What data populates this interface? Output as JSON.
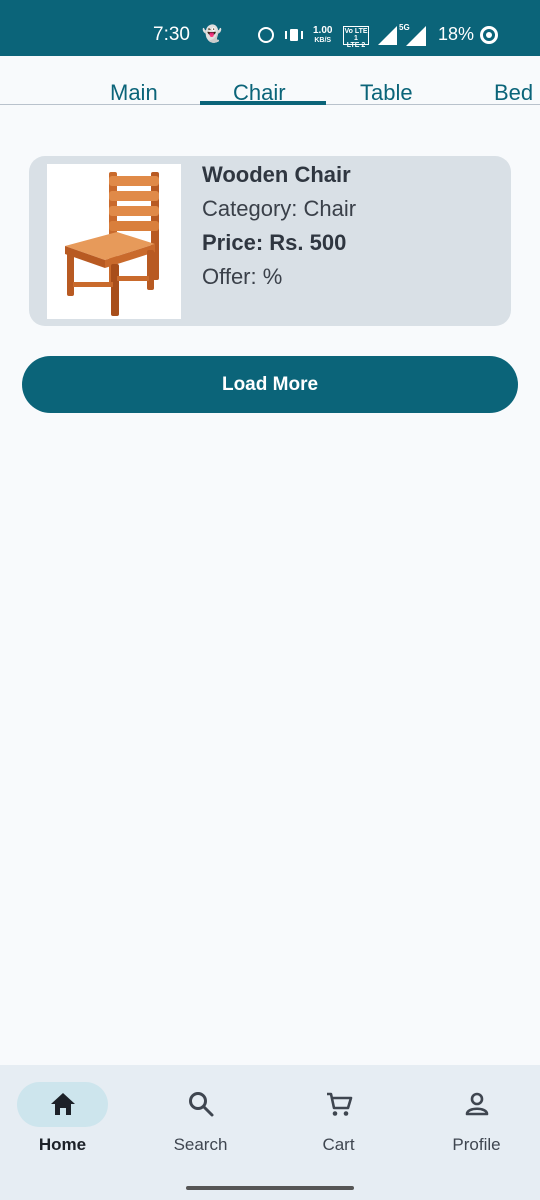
{
  "status_bar": {
    "time": "7:30",
    "net_speed_value": "1.00",
    "net_speed_unit": "KB/S",
    "volte_top": "Vo LTE 1",
    "volte_bottom": "LTE 2",
    "network_badge": "5G",
    "battery": "18%"
  },
  "tabs": {
    "items": [
      {
        "label": "Main"
      },
      {
        "label": "Chair",
        "selected": true
      },
      {
        "label": "Table"
      },
      {
        "label": "Bed"
      }
    ]
  },
  "product": {
    "name": "Wooden Chair",
    "category": "Category: Chair",
    "price": "Price: Rs. 500",
    "offer": "Offer: %",
    "image_icon": "wooden-chair-image"
  },
  "actions": {
    "load_more": "Load More"
  },
  "bottom_nav": {
    "items": [
      {
        "label": "Home",
        "icon": "home-icon",
        "selected": true
      },
      {
        "label": "Search",
        "icon": "search-icon"
      },
      {
        "label": "Cart",
        "icon": "cart-icon"
      },
      {
        "label": "Profile",
        "icon": "profile-icon"
      }
    ]
  },
  "colors": {
    "primary": "#0b6479",
    "card_bg": "#d9e0e6",
    "nav_bg": "#e6edf3",
    "selected_pill": "#cde5ed"
  }
}
